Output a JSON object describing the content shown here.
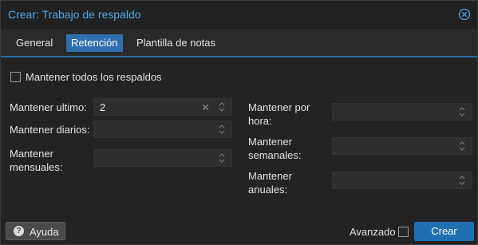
{
  "dialog": {
    "title": "Crear: Trabajo de respaldo",
    "close_icon": "close-circle-icon"
  },
  "tabs": [
    {
      "label": "General",
      "active": false
    },
    {
      "label": "Retención",
      "active": true
    },
    {
      "label": "Plantilla de notas",
      "active": false
    }
  ],
  "retention": {
    "keep_all_label": "Mantener todos los respaldos",
    "keep_all_checked": false,
    "keep_last": {
      "label": "Mantener ultimo:",
      "value": "2"
    },
    "keep_daily": {
      "label": "Mantener diarios:",
      "value": ""
    },
    "keep_monthly": {
      "label_line1": "Mantener",
      "label_line2": "mensuales:",
      "value": ""
    },
    "keep_hourly": {
      "label_line1": "Mantener por",
      "label_line2": "hora:",
      "value": ""
    },
    "keep_weekly": {
      "label_line1": "Mantener",
      "label_line2": "semanales:",
      "value": ""
    },
    "keep_yearly": {
      "label_line1": "Mantener",
      "label_line2": "anuales:",
      "value": ""
    }
  },
  "footer": {
    "help_label": "Ayuda",
    "help_icon": "question-circle-icon",
    "advanced_label": "Avanzado",
    "advanced_checked": false,
    "create_label": "Crear"
  },
  "colors": {
    "accent": "#4fa7ea",
    "active_tab": "#2f6fb0",
    "primary_button": "#1f6fb3"
  }
}
